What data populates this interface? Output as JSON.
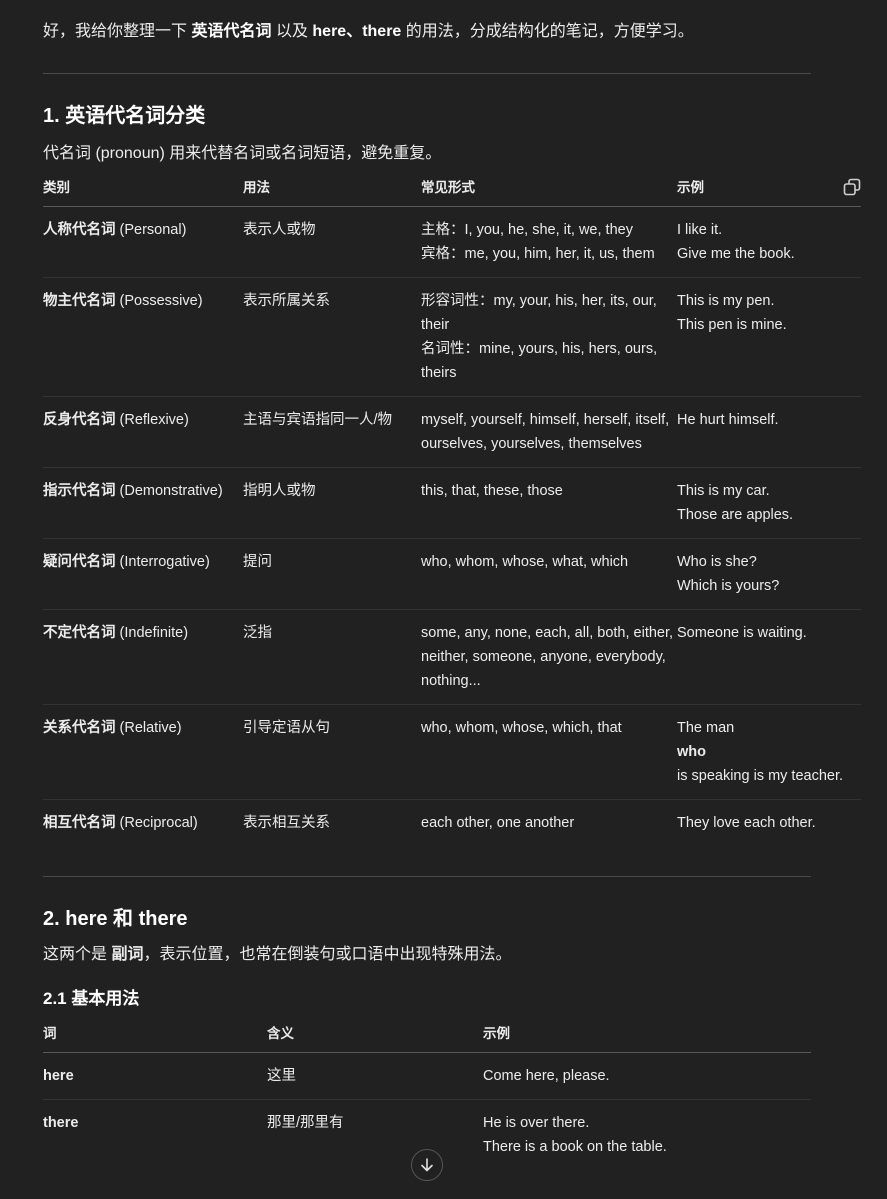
{
  "intro": {
    "p1": "好，我给你整理一下",
    "b1": "英语代名词",
    "p2": "以及",
    "b2": "here、there",
    "p3": "的用法，分成结构化的笔记，方便学习。"
  },
  "section1": {
    "title": "1. 英语代名词分类",
    "lead": "代名词 (pronoun) 用来代替名词或名词短语，避免重复。",
    "headers": [
      "类别",
      "用法",
      "常见形式",
      "示例"
    ],
    "rows": [
      {
        "cat_zh": "人称代名词",
        "cat_en": " (Personal)",
        "usage": "表示人或物",
        "forms": [
          "主格：I, you, he, she, it, we, they",
          "宾格：me, you, him, her, it, us, them"
        ],
        "examples": [
          "I like it.",
          "Give me the book."
        ]
      },
      {
        "cat_zh": "物主代名词",
        "cat_en": " (Possessive)",
        "usage": "表示所属关系",
        "forms": [
          "形容词性：my, your, his, her, its, our, their",
          "名词性：mine, yours, his, hers, ours, theirs"
        ],
        "examples": [
          "This is my pen.",
          "This pen is mine."
        ]
      },
      {
        "cat_zh": "反身代名词",
        "cat_en": " (Reflexive)",
        "usage": "主语与宾语指同一人/物",
        "forms": [
          "myself, yourself, himself, herself, itself, ourselves, yourselves, themselves"
        ],
        "examples": [
          "He hurt himself."
        ]
      },
      {
        "cat_zh": "指示代名词",
        "cat_en": " (Demonstrative)",
        "usage": "指明人或物",
        "forms": [
          "this, that, these, those"
        ],
        "examples": [
          "This is my car.",
          "Those are apples."
        ]
      },
      {
        "cat_zh": "疑问代名词",
        "cat_en": " (Interrogative)",
        "usage": "提问",
        "forms": [
          "who, whom, whose, what, which"
        ],
        "examples": [
          "Who is she?",
          "Which is yours?"
        ]
      },
      {
        "cat_zh": "不定代名词",
        "cat_en": " (Indefinite)",
        "usage": "泛指",
        "forms": [
          "some, any, none, each, all, both, either, neither, someone, anyone, everybody, nothing..."
        ],
        "examples": [
          "Someone is waiting."
        ]
      },
      {
        "cat_zh": "关系代名词",
        "cat_en": " (Relative)",
        "usage": "引导定语从句",
        "forms": [
          "who, whom, whose, which, that"
        ],
        "examples_rich": {
          "pre": "The man ",
          "bold": "who",
          "post": " is speaking is my teacher."
        }
      },
      {
        "cat_zh": "相互代名词",
        "cat_en": " (Reciprocal)",
        "usage": "表示相互关系",
        "forms": [
          "each other, one another"
        ],
        "examples": [
          "They love each other."
        ]
      }
    ]
  },
  "section2": {
    "title": "2. here 和 there",
    "lead_p1": "这两个是 ",
    "lead_b": "副词",
    "lead_p2": "，表示位置，也常在倒装句或口语中出现特殊用法。",
    "sub_title": "2.1 基本用法",
    "headers": [
      "词",
      "含义",
      "示例"
    ],
    "rows": [
      {
        "word": "here",
        "meaning": "这里",
        "examples": [
          "Come here, please."
        ]
      },
      {
        "word": "there",
        "meaning": "那里/那里有",
        "examples": [
          "He is over there.",
          "There is a book on the table."
        ]
      }
    ]
  },
  "icons": {
    "copy": "copy-icon",
    "scroll": "arrow-down-icon"
  }
}
